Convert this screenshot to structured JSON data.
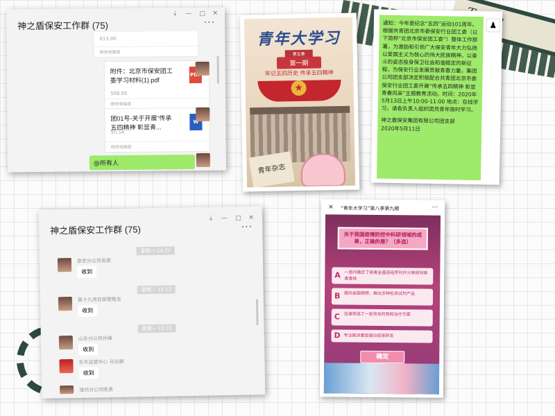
{
  "decor": {
    "tape_text": "Today"
  },
  "chat1": {
    "title": "神之盾保安工作群 (75)",
    "window_controls": [
      "⇣",
      "—",
      "□",
      "✕"
    ],
    "more": "···",
    "top_file": {
      "size": "813.8K",
      "source": "微信电脑版"
    },
    "file1": {
      "name": "附件：北京市保安团工委学习材料(1).pdf",
      "size": "598.8K",
      "source": "微信电脑版",
      "type_label": "PDF"
    },
    "file2": {
      "name": "团01号-关于开展“传承五四精神 彰显青...",
      "size": "90.5K",
      "source": "微信电脑版",
      "type_label": "W"
    },
    "mention": "@所有人"
  },
  "poster1": {
    "title": "青年大学习",
    "season": "第五季",
    "issue": "第一期",
    "slogan": "牢记五四历史 传承五四精神",
    "newspaper": "青年杂志"
  },
  "notice": {
    "body": "通知：今年是纪念“五四”运动101周年。根据共青团北京市委保安行业团工委（以下简称“北京市保安团工委”）整体工作部署，为激励和引领广大保安青年大力弘扬以爱国主义为核心的伟大民族精神，以奋斗的姿态投身保卫社会和谐稳定的新征程，为保安行业发展贡献青春力量，集团公司团支部决定积极配合共青团北京市委保安行业团工委开展“传承五四精神 彰显青春风采”主题教育活动。时间：2020年5月13日上午10:00-11:00 地点：在线学习，请各负责人组织团员青年按时学习。",
    "signature": "神之盾保安集团有限公司团支部",
    "date": "2020年5月11日"
  },
  "chat2": {
    "title": "神之盾保安工作群 (75)",
    "window_controls": [
      "⇣",
      "—",
      "□",
      "✕"
    ],
    "more": "···",
    "messages": [
      {
        "time": "星期一 14:37",
        "sender": "泰安分公司吴蓉",
        "text": "收到"
      },
      {
        "time": "星期一 15:13",
        "sender": "第十九项目部楚敬友",
        "text": "收到"
      },
      {
        "time": "星期一 15:21",
        "sender": "山东分公司孙峰",
        "text": "收到"
      },
      {
        "time": "",
        "sender": "东平运营中心 孙云鹏",
        "text": "收到"
      },
      {
        "time": "",
        "sender": "潍坊分公司陈勇",
        "text": ""
      }
    ]
  },
  "quiz": {
    "close": "✕",
    "header": "“青年大学习”第八季第九期",
    "more": "···",
    "question": "关于我国疫情防控中科研领域的成果，正确的是？（多选）",
    "options": [
      {
        "letter": "A",
        "text": "一周内确定了病毒全基因组序列并分离得到病毒毒株"
      },
      {
        "letter": "B",
        "text": "面向全国揭榜，推出多种检测试剂产品"
      },
      {
        "letter": "C",
        "text": "迅速筛选了一批有效药物和治疗方案"
      },
      {
        "letter": "D",
        "text": "专注推进重组蛋白疫苗研发"
      }
    ],
    "confirm": "确定"
  }
}
